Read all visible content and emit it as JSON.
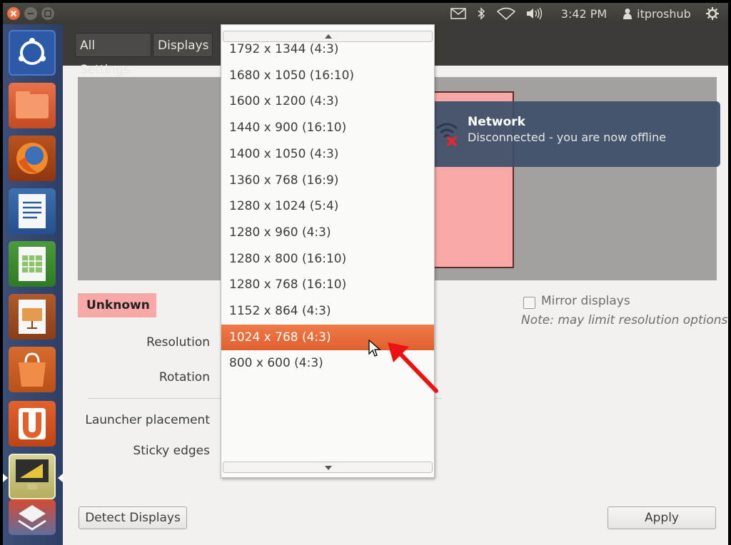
{
  "top_panel": {
    "time": "3:42 PM",
    "user": "itproshub"
  },
  "toolbar": {
    "all_settings": "All Settings",
    "displays": "Displays"
  },
  "notification": {
    "title": "Network",
    "body": "Disconnected - you are now offline"
  },
  "display": {
    "name": "Unknown",
    "labels": {
      "resolution": "Resolution",
      "rotation": "Rotation",
      "launcher_placement": "Launcher placement",
      "sticky_edges": "Sticky edges"
    },
    "mirror_label": "Mirror displays",
    "mirror_checked": false,
    "note": "Note: may limit resolution options"
  },
  "buttons": {
    "detect": "Detect Displays",
    "apply": "Apply"
  },
  "resolution_options": [
    "1792 x 1344 (4:3)",
    "1680 x 1050 (16:10)",
    "1600 x 1200 (4:3)",
    "1440 x 900 (16:10)",
    "1400 x 1050 (4:3)",
    "1360 x 768 (16:9)",
    "1280 x 1024 (5:4)",
    "1280 x 960 (4:3)",
    "1280 x 800 (16:10)",
    "1280 x 768 (16:10)",
    "1152 x 864 (4:3)",
    "1024 x 768 (4:3)",
    "800 x 600 (4:3)"
  ],
  "selected_resolution_index": 11,
  "launcher_icons": [
    "ubuntu-dash-icon",
    "files-icon",
    "firefox-icon",
    "writer-icon",
    "calc-icon",
    "impress-icon",
    "software-center-icon",
    "ubuntu-one-icon",
    "display-settings-icon",
    "workspace-switcher-icon"
  ],
  "colors": {
    "accent": "#e86236",
    "panel": "#3c3b37",
    "launcher": "#33466e",
    "monitor": "#f8a8a6"
  }
}
